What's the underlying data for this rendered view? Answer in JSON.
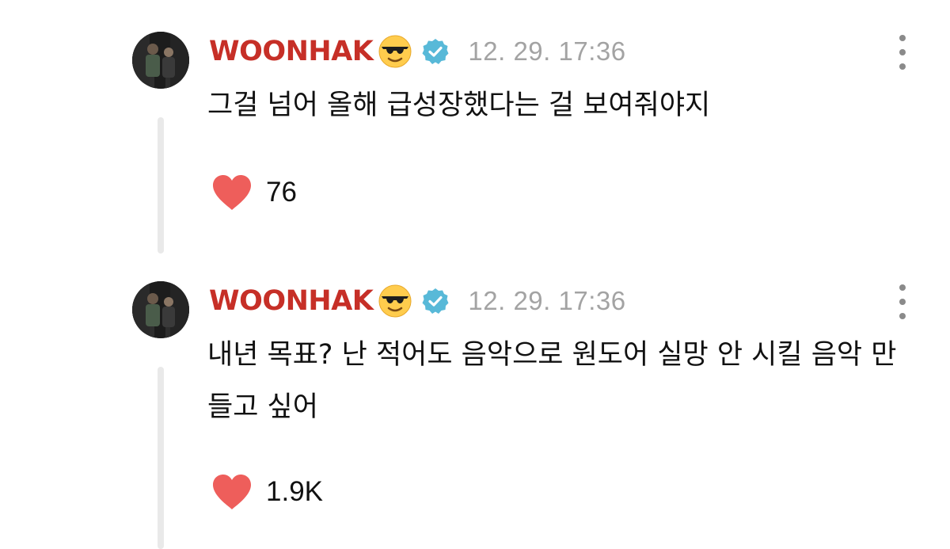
{
  "posts": [
    {
      "username": "WOONHAK",
      "emoji": "😎",
      "verified_icon": "verified-badge-icon",
      "timestamp": "12. 29. 17:36",
      "text": "그걸 넘어 올해 급성장했다는 걸 보여줘야지",
      "likes": "76"
    },
    {
      "username": "WOONHAK",
      "emoji": "😎",
      "verified_icon": "verified-badge-icon",
      "timestamp": "12. 29. 17:36",
      "text": "내년 목표? 난 적어도 음악으로 원도어 실망 안 시킬 음악 만들고 싶어",
      "likes": "1.9K"
    }
  ],
  "colors": {
    "username": "#c62f27",
    "timestamp": "#a3a3a3",
    "heart": "#ee5e5b",
    "verified": "#58b9d8",
    "thread_line": "#e9e9e9"
  }
}
